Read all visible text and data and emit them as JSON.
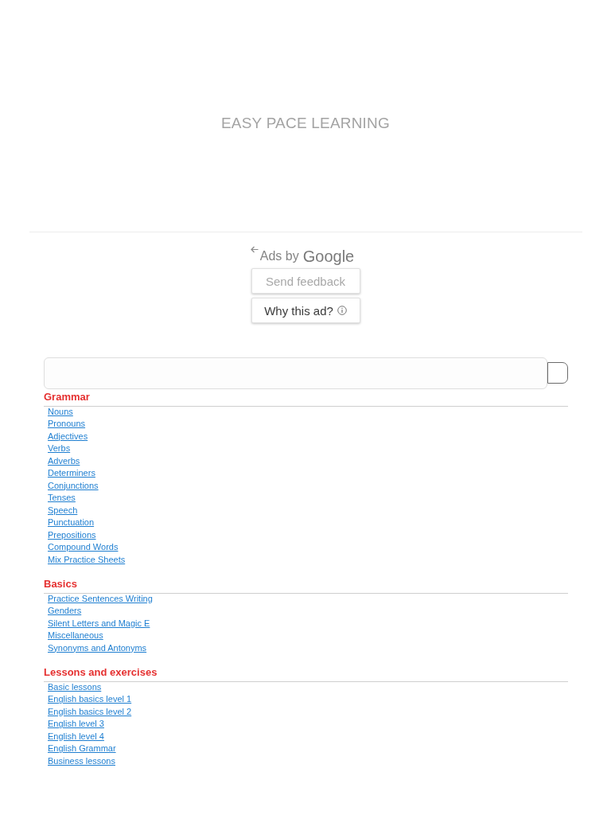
{
  "header": {
    "title": "EASY PACE LEARNING"
  },
  "ad": {
    "label": "Ads by",
    "brand": "Google",
    "buttons": [
      {
        "label": "Send feedback",
        "kind": "feedback"
      },
      {
        "label": "Why this ad?",
        "kind": "info"
      }
    ]
  },
  "sections": [
    {
      "title": "Grammar",
      "links": [
        "Nouns",
        "Pronouns",
        "Adjectives",
        "Verbs",
        "Adverbs",
        "Determiners",
        "Conjunctions",
        "Tenses",
        "Speech",
        "Punctuation",
        "Prepositions",
        "Compound Words",
        "Mix Practice Sheets"
      ]
    },
    {
      "title": "Basics",
      "links": [
        "Practice Sentences Writing",
        "Genders",
        "Silent Letters and Magic E",
        "Miscellaneous",
        "Synonyms and Antonyms"
      ]
    },
    {
      "title": "Lessons and exercises",
      "links": [
        "Basic lessons",
        "English basics level 1",
        "English basics level 2",
        "English level 3",
        "English level 4",
        "English Grammar",
        "Business lessons"
      ]
    }
  ]
}
